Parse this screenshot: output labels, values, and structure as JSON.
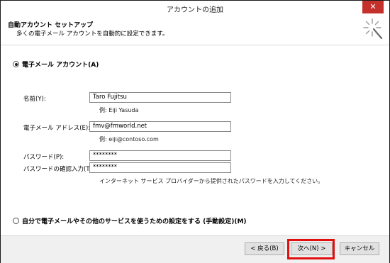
{
  "window": {
    "title": "アカウントの追加",
    "close_glyph": "✕"
  },
  "header": {
    "title": "自動アカウント セットアップ",
    "subtitle": "多くの電子メール アカウントを自動的に設定できます。",
    "icon": "wizard-wand-icon"
  },
  "email_account_option": {
    "label": "電子メール アカウント(A)",
    "selected": true
  },
  "fields": {
    "name": {
      "label": "名前(Y):",
      "value": "Taro Fujitsu",
      "hint": "例: Eiji Yasuda"
    },
    "email": {
      "label": "電子メール アドレス(E):",
      "value": "fmv@fmworld.net",
      "hint": "例: eiji@contoso.com"
    },
    "password": {
      "label": "パスワード(P):",
      "value": "********"
    },
    "password_confirm": {
      "label": "パスワードの確認入力(T):",
      "value": "********",
      "hint": "インターネット サービス プロバイダーから提供されたパスワードを入力してください。"
    }
  },
  "manual_option": {
    "label": "自分で電子メールやその他のサービスを使うための設定をする (手動設定)(M)",
    "selected": false
  },
  "buttons": {
    "back": "< 戻る(B)",
    "next": "次へ(N) >",
    "cancel": "キャンセル"
  },
  "highlight_color": "#e01010"
}
